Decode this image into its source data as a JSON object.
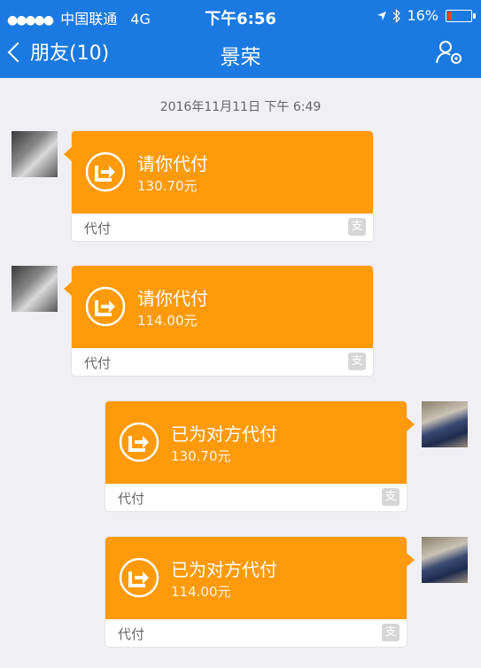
{
  "status_bar": {
    "signal_dots": "●●●●●",
    "carrier": "中国联通",
    "network": "4G",
    "time": "下午6:56",
    "battery_percent": "16%",
    "battery_color": "#ff3b30"
  },
  "nav": {
    "back_label": "朋友(10)",
    "title": "景荣",
    "settings_icon": "user-settings-icon"
  },
  "chat": {
    "timestamp": "2016年11月11日 下午 6:49",
    "messages": [
      {
        "side": "left",
        "title": "请你代付",
        "amount": "130.70元",
        "footer": "代付",
        "badge": "支"
      },
      {
        "side": "left",
        "title": "请你代付",
        "amount": "114.00元",
        "footer": "代付",
        "badge": "支"
      },
      {
        "side": "right",
        "title": "已为对方代付",
        "amount": "130.70元",
        "footer": "代付",
        "badge": "支"
      },
      {
        "side": "right",
        "title": "已为对方代付",
        "amount": "114.00元",
        "footer": "代付",
        "badge": "支"
      }
    ]
  },
  "colors": {
    "header_blue": "#1a7ae1",
    "card_orange": "#ff9a0a",
    "background": "#efeff4"
  }
}
